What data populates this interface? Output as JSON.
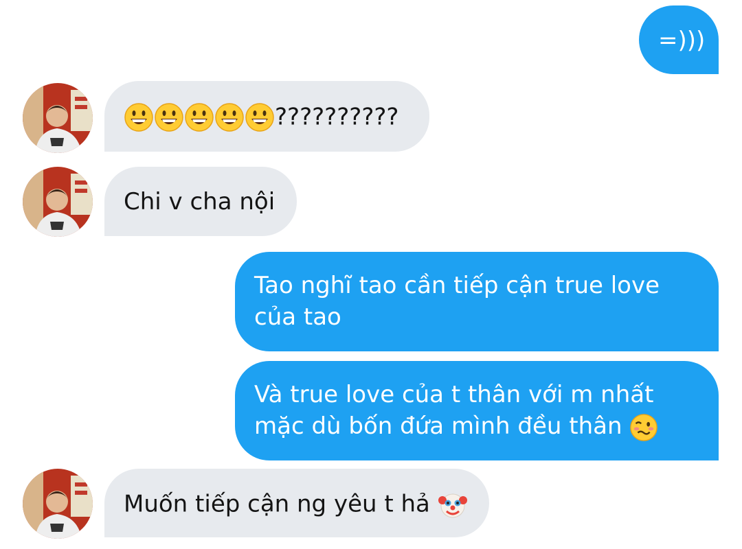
{
  "messages": [
    {
      "sender": "me",
      "text": "=)))"
    },
    {
      "sender": "friend",
      "text": "??????????",
      "emoji": "grinning-face-icon x5"
    },
    {
      "sender": "friend",
      "text": "Chi v cha nội"
    },
    {
      "sender": "me",
      "lines": [
        "Tao nghĩ tao cần tiếp cận true love",
        "của tao"
      ]
    },
    {
      "sender": "me",
      "lines": [
        "Và true love của t thân với m nhất",
        "mặc dù bốn đứa mình đều thân"
      ],
      "emoji": "woozy-face-icon"
    },
    {
      "sender": "friend",
      "text": "Muốn tiếp cận ng yêu t hả",
      "emoji": "clown-face-icon"
    }
  ],
  "colors": {
    "outgoing_bubble": "#1ea1f2",
    "incoming_bubble": "#e7eaee",
    "outgoing_text": "#ffffff",
    "incoming_text": "#141414"
  }
}
